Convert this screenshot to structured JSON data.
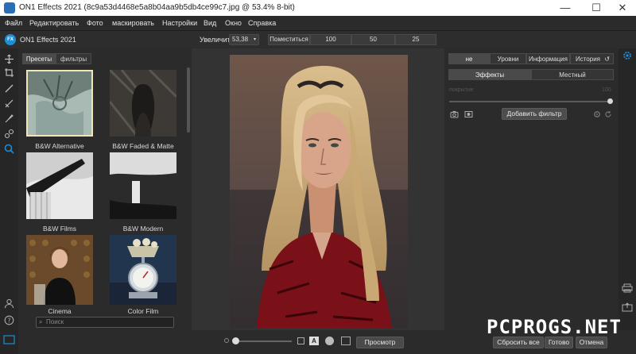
{
  "window": {
    "title": "ON1 Effects 2021 (8c9a53d4468e5a8b04aa9b5db4ce99c7.jpg @ 53.4% 8-bit)",
    "minimize_glyph": "—",
    "maximize_glyph": "☐",
    "close_glyph": "✕"
  },
  "menu": {
    "items": [
      "Файл",
      "Редактировать",
      "Фото",
      "маскировать",
      "Настройки",
      "Вид",
      "Окно",
      "Справка"
    ]
  },
  "toolbar": {
    "logo_text": "FX",
    "app_name": "ON1 Effects 2021",
    "zoom_label": "Увеличить",
    "zoom_value": "53,38",
    "fit_label": "Поместиться",
    "zoom_presets": [
      "100",
      "50",
      "25"
    ]
  },
  "browser": {
    "tabs": [
      "Пресеты",
      "фильтры"
    ],
    "presets": [
      {
        "label": "B&W Alternative"
      },
      {
        "label": "B&W Faded & Matte"
      },
      {
        "label": "B&W Films"
      },
      {
        "label": "B&W Modern"
      },
      {
        "label": "Cinema"
      },
      {
        "label": "Color Film"
      }
    ],
    "search_placeholder": "Поиск"
  },
  "right_panel": {
    "top_tabs": [
      "не",
      "Уровни",
      "Информация",
      "История"
    ],
    "sub_tabs": [
      "Эффекты",
      "Местный"
    ],
    "slider_label": "покрытие",
    "slider_value": "100",
    "slider_level": 1.0,
    "add_filter_label": "Добавить фильтр"
  },
  "bottom": {
    "preview_label": "Просмотр",
    "reset_label": "Сбросить все",
    "done_label": "Готово",
    "cancel_label": "Отмена",
    "mode_letter": "A"
  },
  "watermark": "PCPROGS.NET",
  "colors": {
    "accent": "#1c8fd6",
    "panel": "#2b2b2b",
    "selected_tab": "#4a4a4a"
  }
}
